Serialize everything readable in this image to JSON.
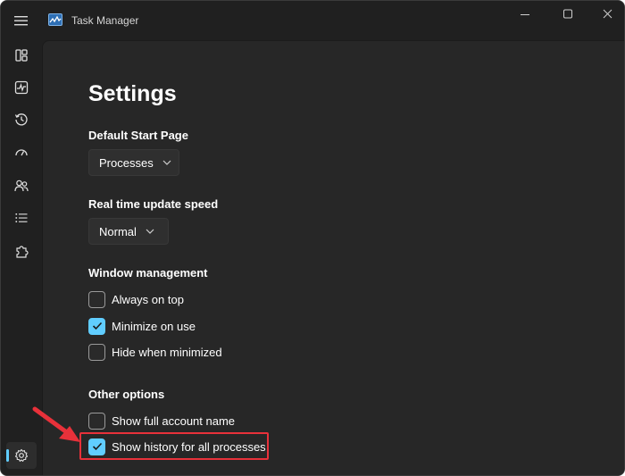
{
  "window": {
    "title": "Task Manager"
  },
  "icons": {
    "menu": "hamburger-menu-icon",
    "app": "task-manager-icon",
    "minimize": "minimize-icon",
    "maximize": "maximize-icon",
    "close": "close-icon"
  },
  "sidebar": {
    "items": [
      {
        "name": "processes",
        "icon": "processes-icon"
      },
      {
        "name": "performance",
        "icon": "performance-icon"
      },
      {
        "name": "app-history",
        "icon": "history-icon"
      },
      {
        "name": "startup-apps",
        "icon": "speedometer-icon"
      },
      {
        "name": "users",
        "icon": "users-icon"
      },
      {
        "name": "details",
        "icon": "list-icon"
      },
      {
        "name": "services",
        "icon": "puzzle-icon"
      }
    ],
    "settings": {
      "name": "settings",
      "icon": "gear-icon",
      "selected": true
    }
  },
  "settings": {
    "title": "Settings",
    "default_start_page": {
      "label": "Default Start Page",
      "value": "Processes"
    },
    "update_speed": {
      "label": "Real time update speed",
      "value": "Normal"
    },
    "window_management": {
      "label": "Window management",
      "options": [
        {
          "label": "Always on top",
          "checked": false
        },
        {
          "label": "Minimize on use",
          "checked": true
        },
        {
          "label": "Hide when minimized",
          "checked": false
        }
      ]
    },
    "other_options": {
      "label": "Other options",
      "options": [
        {
          "label": "Show full account name",
          "checked": false
        },
        {
          "label": "Show history for all processes",
          "checked": true
        }
      ]
    }
  },
  "colors": {
    "accent": "#60cdff",
    "highlight": "#e8313a",
    "background": "#272727",
    "titlebar": "#202020"
  }
}
